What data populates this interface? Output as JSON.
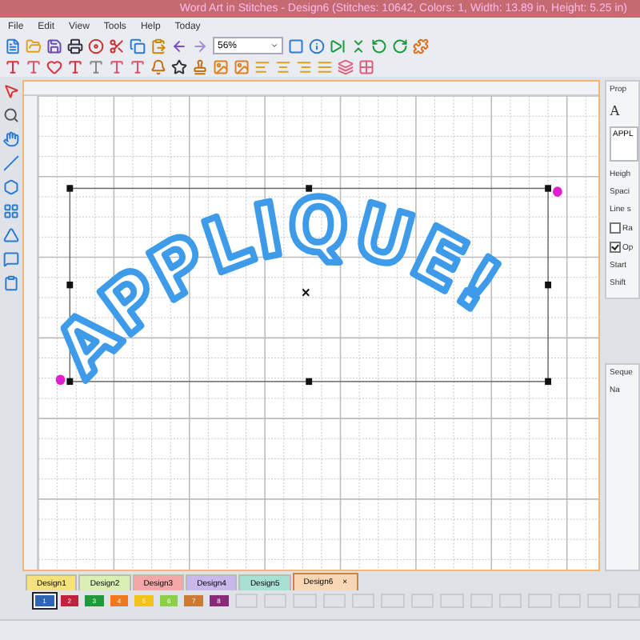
{
  "window": {
    "title": "Word Art in Stitches - Design6 (Stitches: 10642, Colors: 1, Width: 13.89 in, Height: 5.25 in)"
  },
  "menu": [
    "File",
    "Edit",
    "View",
    "Tools",
    "Help",
    "Today"
  ],
  "zoom": {
    "value": "56%"
  },
  "design": {
    "text": "APPLIQUE!"
  },
  "properties_panel": {
    "title": "Prop",
    "font_preview": "A",
    "text_value": "APPL",
    "labels": [
      "Heigh",
      "Spaci",
      "Line s"
    ],
    "options": [
      {
        "label": "Ra",
        "checked": false
      },
      {
        "label": "Op",
        "checked": true
      }
    ],
    "labels2": [
      "Start",
      "Shift"
    ]
  },
  "sequence_panel": {
    "title": "Seque",
    "column": "Na"
  },
  "tabs": {
    "close": "×",
    "items": [
      {
        "label": "Design1",
        "color": "#f6e27a",
        "selected": false
      },
      {
        "label": "Design2",
        "color": "#d9efb3",
        "selected": false
      },
      {
        "label": "Design3",
        "color": "#f2a8a8",
        "selected": false
      },
      {
        "label": "Design4",
        "color": "#c9b8ec",
        "selected": false
      },
      {
        "label": "Design5",
        "color": "#a8e0d4",
        "selected": false
      },
      {
        "label": "Design6",
        "color": "#f8d8b4",
        "selected": true
      }
    ]
  },
  "swatches": [
    {
      "label": "1",
      "color": "#2f66b3",
      "selected": true
    },
    {
      "label": "2",
      "color": "#c0213d",
      "selected": false
    },
    {
      "label": "3",
      "color": "#1f9a3a",
      "selected": false
    },
    {
      "label": "4",
      "color": "#f2781e",
      "selected": false
    },
    {
      "label": "5",
      "color": "#f2c318",
      "selected": false
    },
    {
      "label": "6",
      "color": "#8ccf4a",
      "selected": false
    },
    {
      "label": "7",
      "color": "#c97b35",
      "selected": false
    },
    {
      "label": "8",
      "color": "#8a2a7a",
      "selected": false
    }
  ]
}
